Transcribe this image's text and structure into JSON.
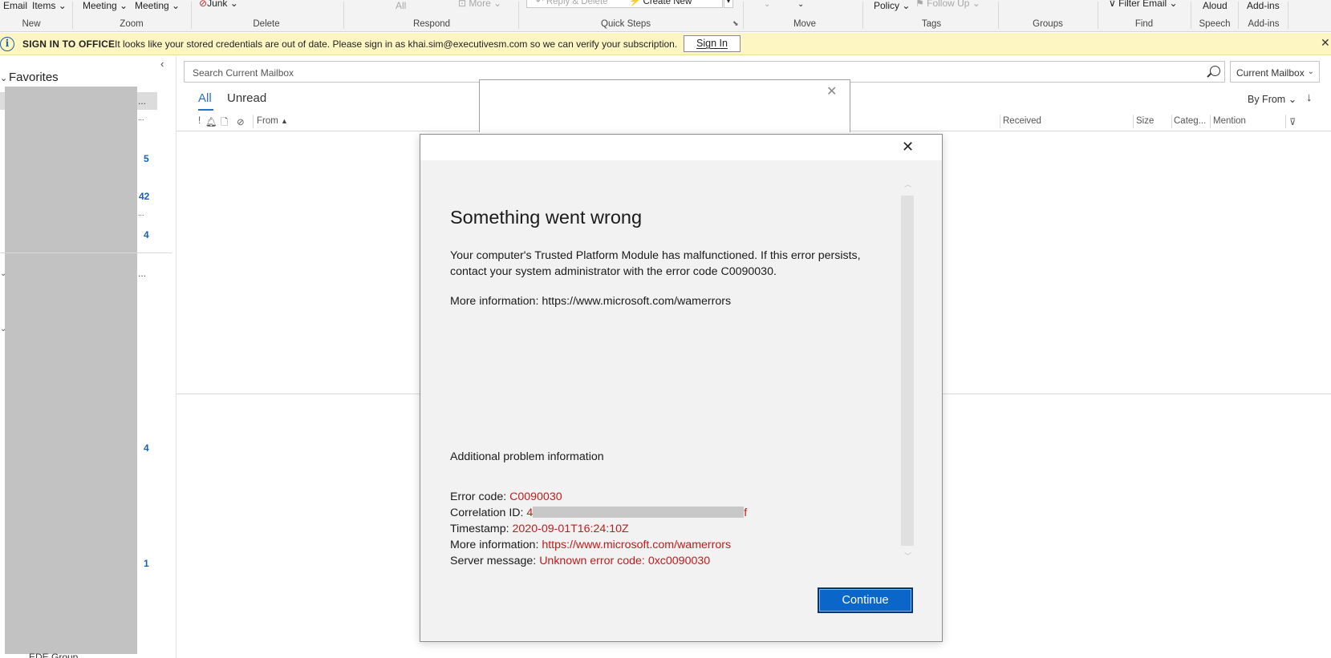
{
  "ribbon": {
    "items": [
      {
        "name": "email",
        "label": "Email",
        "dimmed": false
      },
      {
        "name": "items",
        "label": "Items",
        "dropdown": true,
        "dimmed": false
      },
      {
        "name": "meeting-1",
        "label": "Meeting",
        "dropdown": true,
        "dimmed": false
      },
      {
        "name": "meeting-2",
        "label": "Meeting",
        "dropdown": true,
        "dimmed": false
      },
      {
        "name": "junk",
        "label": "Junk",
        "dropdown": true,
        "dimmed": false
      },
      {
        "name": "reply-all",
        "label": "All",
        "dimmed": true
      },
      {
        "name": "more",
        "label": "More",
        "dropdown": true,
        "dimmed": true
      },
      {
        "name": "reply-delete",
        "label": "Reply & Delete",
        "dimmed": true
      },
      {
        "name": "create-new",
        "label": "Create New",
        "dimmed": false
      },
      {
        "name": "policy",
        "label": "Policy",
        "dropdown": true,
        "dimmed": false
      },
      {
        "name": "follow-up",
        "label": "Follow Up",
        "dropdown": true,
        "dimmed": true
      },
      {
        "name": "filter-email",
        "label": "Filter Email",
        "dropdown": true,
        "dimmed": false
      },
      {
        "name": "read-aloud",
        "label": "Aloud",
        "dimmed": false
      },
      {
        "name": "addins-btn",
        "label": "Add-ins",
        "dimmed": false
      }
    ],
    "groups": [
      "New",
      "Zoom",
      "Delete",
      "Respond",
      "Quick Steps",
      "Move",
      "Tags",
      "Groups",
      "Find",
      "Speech",
      "Add-ins"
    ]
  },
  "infobar": {
    "title": "SIGN IN TO OFFICE",
    "message": "It looks like your stored credentials are out of date. Please sign in as khai.sim@executivesm.com so we can verify your subscription.",
    "button": "Sign In",
    "close": "✕"
  },
  "folders": {
    "favorites": "Favorites",
    "counts": [
      "5",
      "42",
      "4",
      "4",
      "1"
    ],
    "bottom_label": "EDE Group"
  },
  "search": {
    "placeholder": "Search Current Mailbox",
    "scope": "Current Mailbox"
  },
  "tabs": {
    "all": "All",
    "unread": "Unread",
    "sort": "By From"
  },
  "columns": [
    "!",
    "From",
    "Received",
    "Size",
    "Categ...",
    "Mention"
  ],
  "dialog": {
    "title": "Something went wrong",
    "body": "Your computer's Trusted Platform Module has malfunctioned. If this error persists, contact your system administrator with the error code C0090030.",
    "more_info": "More information: https://www.microsoft.com/wamerrors",
    "additional": "Additional problem information",
    "error_code_label": "Error code: ",
    "error_code": "C0090030",
    "correlation_label": "Correlation ID: ",
    "correlation_start": "4",
    "correlation_end": "f",
    "timestamp_label": "Timestamp: ",
    "timestamp": "2020-09-01T16:24:10Z",
    "more_label": "More information: ",
    "more_url": "https://www.microsoft.com/wamerrors",
    "server_label": "Server message: ",
    "server_message": "Unknown error code: 0xc0090030",
    "continue": "Continue"
  }
}
